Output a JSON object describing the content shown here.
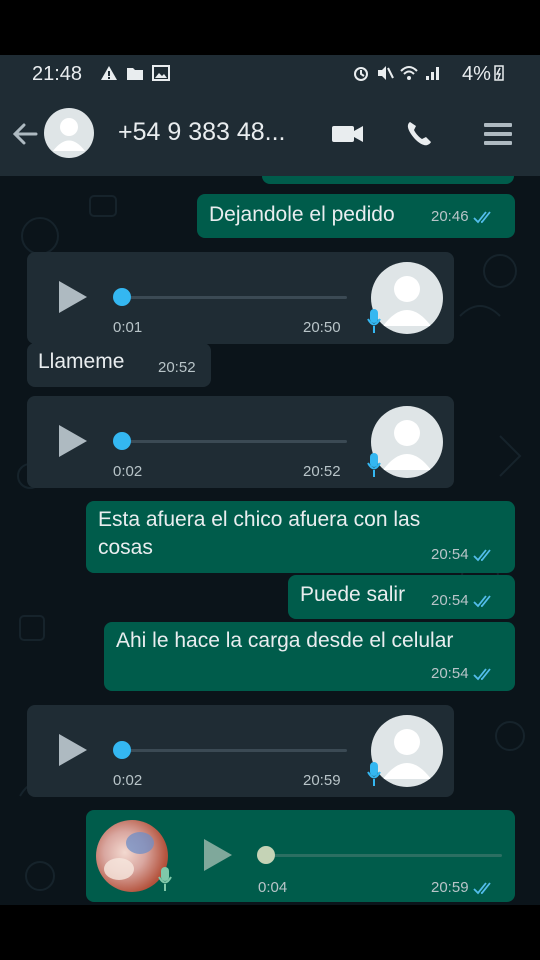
{
  "status_bar": {
    "time": "21:48",
    "battery": "4%"
  },
  "header": {
    "contact": "+54 9 383 48..."
  },
  "messages": [
    {
      "kind": "text",
      "text": "Dejandole el pedido",
      "time": "20:46"
    },
    {
      "kind": "voice",
      "duration": "0:01",
      "time": "20:50"
    },
    {
      "kind": "text",
      "text": "Llameme",
      "time": "20:52"
    },
    {
      "kind": "voice",
      "duration": "0:02",
      "time": "20:52"
    },
    {
      "kind": "text",
      "line1": "Esta  afuera el chico afuera con las",
      "line2": "cosas",
      "time": "20:54"
    },
    {
      "kind": "text",
      "text": "Puede salir",
      "time": "20:54"
    },
    {
      "kind": "text",
      "text": "Ahi le hace la carga desde el celular",
      "time": "20:54"
    },
    {
      "kind": "voice",
      "duration": "0:02",
      "time": "20:59"
    },
    {
      "kind": "voice",
      "duration": "0:04",
      "time": "20:59"
    }
  ],
  "colors": {
    "incoming": "#1f2c34",
    "outgoing": "#005c4b",
    "read_ticks": "#53bdeb",
    "voice_dot": "#34b7f1"
  },
  "icons": [
    "back-arrow-icon",
    "avatar-icon",
    "video-call-icon",
    "phone-icon",
    "menu-icon",
    "play-icon",
    "mic-icon",
    "double-check-icon"
  ]
}
